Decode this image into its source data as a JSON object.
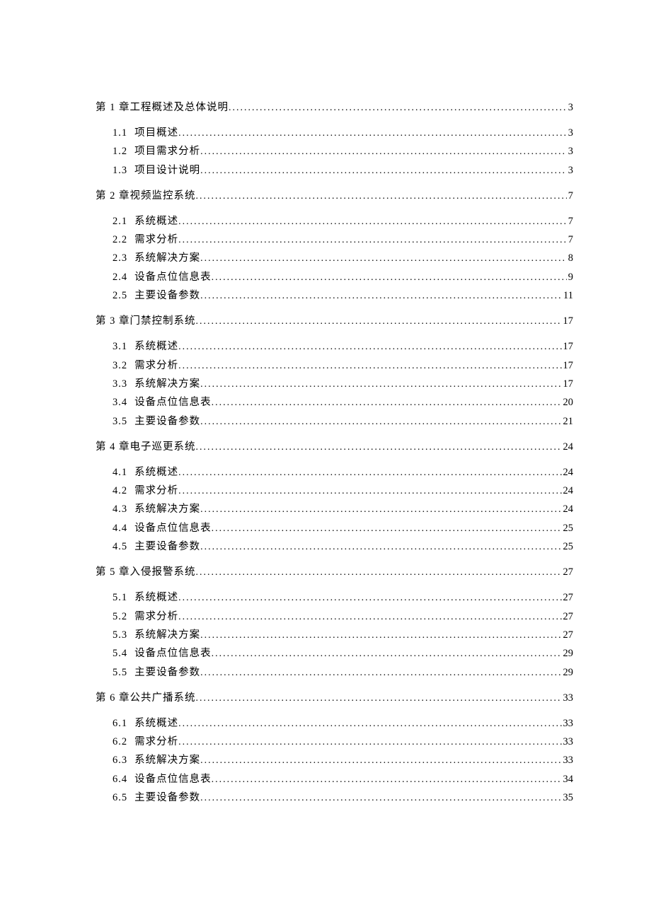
{
  "toc": [
    {
      "level": 1,
      "num": "第 1 章",
      "title": "工程概述及总体说明",
      "page": "3"
    },
    {
      "level": 2,
      "num": "1.1",
      "title": "项目概述",
      "page": "3"
    },
    {
      "level": 2,
      "num": "1.2",
      "title": "项目需求分析",
      "page": "3"
    },
    {
      "level": 2,
      "num": "1.3",
      "title": "项目设计说明",
      "page": "3"
    },
    {
      "level": 1,
      "num": "第 2 章",
      "title": "视频监控系统",
      "page": "7"
    },
    {
      "level": 2,
      "num": "2.1",
      "title": "系统概述",
      "page": "7"
    },
    {
      "level": 2,
      "num": "2.2",
      "title": "需求分析",
      "page": "7"
    },
    {
      "level": 2,
      "num": "2.3",
      "title": "系统解决方案",
      "page": "8"
    },
    {
      "level": 2,
      "num": "2.4",
      "title": "设备点位信息表",
      "page": "9"
    },
    {
      "level": 2,
      "num": "2.5",
      "title": "主要设备参数",
      "page": "11"
    },
    {
      "level": 1,
      "num": "第 3 章",
      "title": "门禁控制系统",
      "page": "17"
    },
    {
      "level": 2,
      "num": "3.1",
      "title": "系统概述",
      "page": "17"
    },
    {
      "level": 2,
      "num": "3.2",
      "title": "需求分析",
      "page": "17"
    },
    {
      "level": 2,
      "num": "3.3",
      "title": "系统解决方案",
      "page": "17"
    },
    {
      "level": 2,
      "num": "3.4",
      "title": "设备点位信息表",
      "page": "20"
    },
    {
      "level": 2,
      "num": "3.5",
      "title": "主要设备参数",
      "page": "21"
    },
    {
      "level": 1,
      "num": "第 4 章",
      "title": "电子巡更系统",
      "page": "24"
    },
    {
      "level": 2,
      "num": "4.1",
      "title": "系统概述",
      "page": "24"
    },
    {
      "level": 2,
      "num": "4.2",
      "title": "需求分析",
      "page": "24"
    },
    {
      "level": 2,
      "num": "4.3",
      "title": "系统解决方案",
      "page": "24"
    },
    {
      "level": 2,
      "num": "4.4",
      "title": "设备点位信息表",
      "page": "25"
    },
    {
      "level": 2,
      "num": "4.5",
      "title": "主要设备参数",
      "page": "25"
    },
    {
      "level": 1,
      "num": "第 5 章",
      "title": "入侵报警系统",
      "page": "27"
    },
    {
      "level": 2,
      "num": "5.1",
      "title": "系统概述",
      "page": "27"
    },
    {
      "level": 2,
      "num": "5.2",
      "title": "需求分析",
      "page": "27"
    },
    {
      "level": 2,
      "num": "5.3",
      "title": "系统解决方案",
      "page": "27"
    },
    {
      "level": 2,
      "num": "5.4",
      "title": "设备点位信息表",
      "page": "29"
    },
    {
      "level": 2,
      "num": "5.5",
      "title": "主要设备参数",
      "page": "29"
    },
    {
      "level": 1,
      "num": "第 6 章",
      "title": "公共广播系统",
      "page": "33"
    },
    {
      "level": 2,
      "num": "6.1",
      "title": "系统概述",
      "page": "33"
    },
    {
      "level": 2,
      "num": "6.2",
      "title": "需求分析",
      "page": "33"
    },
    {
      "level": 2,
      "num": "6.3",
      "title": "系统解决方案",
      "page": "33"
    },
    {
      "level": 2,
      "num": "6.4",
      "title": "设备点位信息表",
      "page": "34"
    },
    {
      "level": 2,
      "num": "6.5",
      "title": "主要设备参数",
      "page": "35"
    }
  ]
}
